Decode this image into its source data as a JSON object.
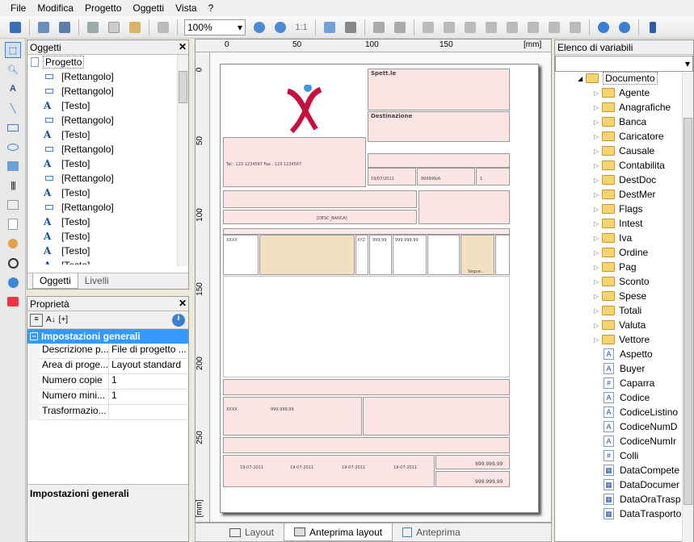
{
  "menu": [
    "File",
    "Modifica",
    "Progetto",
    "Oggetti",
    "Vista",
    "?"
  ],
  "toolbar": {
    "zoom": "100%",
    "zoom_ratio": "1:1"
  },
  "objects_panel": {
    "title": "Oggetti",
    "root": "Progetto",
    "items": [
      {
        "type": "rect",
        "label": "[Rettangolo]"
      },
      {
        "type": "rect",
        "label": "[Rettangolo]"
      },
      {
        "type": "text",
        "label": "[Testo]"
      },
      {
        "type": "rect",
        "label": "[Rettangolo]"
      },
      {
        "type": "text",
        "label": "[Testo]"
      },
      {
        "type": "rect",
        "label": "[Rettangolo]"
      },
      {
        "type": "text",
        "label": "[Testo]"
      },
      {
        "type": "rect",
        "label": "[Rettangolo]"
      },
      {
        "type": "text",
        "label": "[Testo]"
      },
      {
        "type": "rect",
        "label": "[Rettangolo]"
      },
      {
        "type": "text",
        "label": "[Testo]"
      },
      {
        "type": "text",
        "label": "[Testo]"
      },
      {
        "type": "text",
        "label": "[Testo]"
      },
      {
        "type": "text",
        "label": "[Testo]"
      }
    ],
    "tabs": [
      "Oggetti",
      "Livelli"
    ]
  },
  "properties_panel": {
    "title": "Proprietà",
    "sort_label": "[+]",
    "group": "Impostazioni generali",
    "rows": [
      {
        "name": "Descrizione p...",
        "value": "File di progetto ..."
      },
      {
        "name": "Area di proge...",
        "value": "Layout standard"
      },
      {
        "name": "Numero copie",
        "value": "1"
      },
      {
        "name": "Numero mini...",
        "value": "1"
      },
      {
        "name": "Trasformazio...",
        "value": ""
      }
    ],
    "description_title": "Impostazioni generali"
  },
  "ruler": {
    "unit": "[mm]",
    "h_ticks": [
      "0",
      "50",
      "100",
      "150"
    ],
    "v_ticks": [
      "0",
      "50",
      "100",
      "150",
      "200",
      "250"
    ]
  },
  "bottom_tabs": [
    "Layout",
    "Anteprima layout",
    "Anteprima"
  ],
  "variables_panel": {
    "title": "Elenco di variabili",
    "root": "Documento",
    "folders": [
      "Agente",
      "Anagrafiche",
      "Banca",
      "Caricatore",
      "Causale",
      "Contabilita",
      "DestDoc",
      "DestMer",
      "Flags",
      "Intest",
      "Iva",
      "Ordine",
      "Pag",
      "Sconto",
      "Spese",
      "Totali",
      "Valuta",
      "Vettore"
    ],
    "fields": [
      {
        "icon": "A",
        "label": "Aspetto"
      },
      {
        "icon": "A",
        "label": "Buyer"
      },
      {
        "icon": "#",
        "label": "Caparra"
      },
      {
        "icon": "A",
        "label": "Codice"
      },
      {
        "icon": "A",
        "label": "CodiceListino"
      },
      {
        "icon": "A",
        "label": "CodiceNumD"
      },
      {
        "icon": "A",
        "label": "CodiceNumIr"
      },
      {
        "icon": "#",
        "label": "Colli"
      },
      {
        "icon": "cal",
        "label": "DataCompete"
      },
      {
        "icon": "cal",
        "label": "DataDocumer"
      },
      {
        "icon": "cal",
        "label": "DataOraTrasp"
      },
      {
        "icon": "cal",
        "label": "DataTrasporto"
      }
    ]
  },
  "document": {
    "dest_title": "Spett.le",
    "dest2_title": "Destinazione",
    "phone_line": "Tel.: 123 1234567 Fax.: 123 1234567",
    "date": "19/07/2011",
    "docnum": "999999/A",
    "page": "1",
    "banca": "[DESC_BANCA]",
    "qty": "999,99",
    "price": "999.999,99",
    "seg": "Segue...",
    "code_x": "XXXX",
    "um": "XYZ",
    "ddate": "19-07-2011"
  },
  "colors": {
    "accent": "#3c7fd1",
    "selection": "#3399ff",
    "doc_pink": "#fbe4e4",
    "doc_tan": "#f1e1c0",
    "logo": "#c8103e"
  }
}
